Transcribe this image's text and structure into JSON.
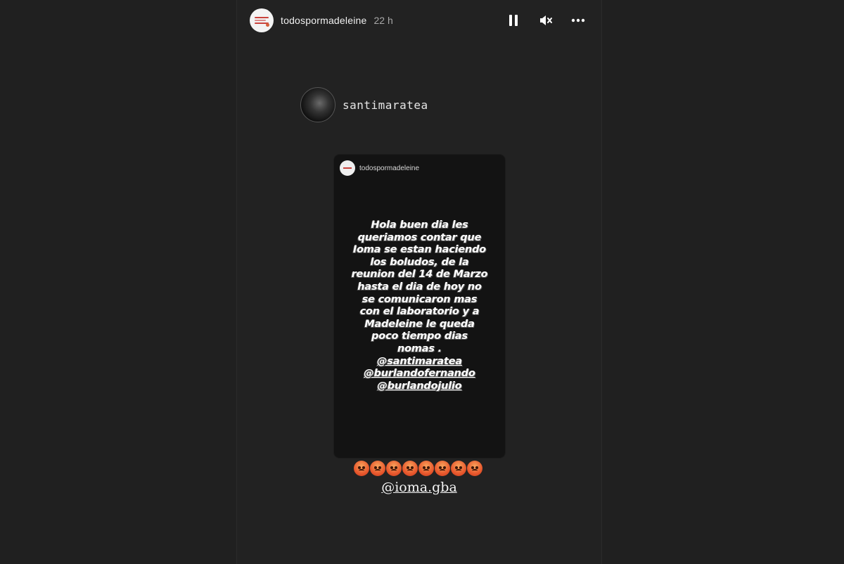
{
  "story": {
    "username": "todospormadeleine",
    "time_ago": "22 h",
    "controls": {
      "pause_icon": "pause-icon",
      "mute_icon": "muted-speaker-icon",
      "more_icon": "more-horizontal-icon"
    }
  },
  "repost": {
    "username": "santimaratea"
  },
  "card": {
    "username": "todospormadeleine",
    "lines": [
      "Hola buen dia les",
      "queriamos contar que",
      "Ioma se estan haciendo",
      "los boludos, de la",
      "reunion del 14 de Marzo",
      "hasta el dia de hoy no",
      "se comunicaron mas",
      "con el laboratorio y a",
      "Madeleine le queda",
      "poco tiempo dias",
      "nomas ."
    ],
    "mentions": [
      "@santimaratea",
      "@burlandofernando",
      "@burlandojulio"
    ]
  },
  "reaction": {
    "emoji": "angry-face-emoji",
    "count": 8
  },
  "tag": "@ioma.gba",
  "colors": {
    "background": "#202020",
    "story_bg": "#222222",
    "card_bg": "#131313",
    "text": "#f0f0f0",
    "muted_text": "#a8a8a8"
  }
}
